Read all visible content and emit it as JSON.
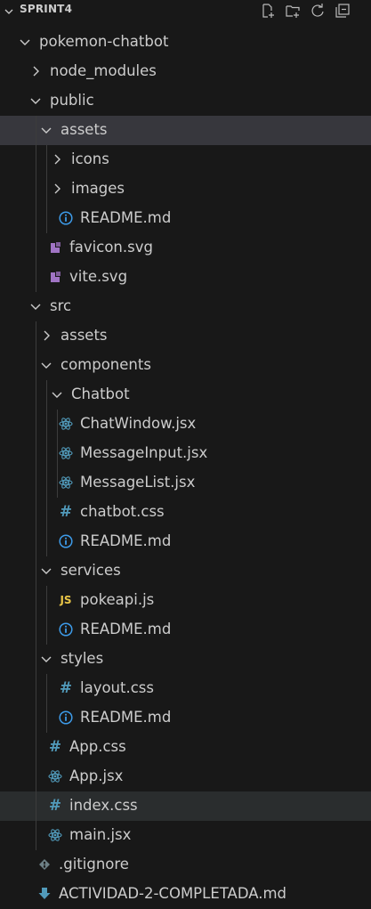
{
  "explorer": {
    "section_title": "SPRINT4",
    "actions": [
      "new-file-icon",
      "new-folder-icon",
      "refresh-icon",
      "collapse-all-icon"
    ]
  },
  "tree": [
    {
      "label": "pokemon-chatbot",
      "depth": 0,
      "kind": "folder",
      "expanded": true
    },
    {
      "label": "node_modules",
      "depth": 1,
      "kind": "folder",
      "expanded": false
    },
    {
      "label": "public",
      "depth": 1,
      "kind": "folder",
      "expanded": true
    },
    {
      "label": "assets",
      "depth": 2,
      "kind": "folder",
      "expanded": true,
      "selected": true
    },
    {
      "label": "icons",
      "depth": 3,
      "kind": "folder",
      "expanded": false
    },
    {
      "label": "images",
      "depth": 3,
      "kind": "folder",
      "expanded": false
    },
    {
      "label": "README.md",
      "depth": 3,
      "kind": "info"
    },
    {
      "label": "favicon.svg",
      "depth": 2,
      "kind": "svg"
    },
    {
      "label": "vite.svg",
      "depth": 2,
      "kind": "svg"
    },
    {
      "label": "src",
      "depth": 1,
      "kind": "folder",
      "expanded": true
    },
    {
      "label": "assets",
      "depth": 2,
      "kind": "folder",
      "expanded": false
    },
    {
      "label": "components",
      "depth": 2,
      "kind": "folder",
      "expanded": true
    },
    {
      "label": "Chatbot",
      "depth": 3,
      "kind": "folder",
      "expanded": true
    },
    {
      "label": "ChatWindow.jsx",
      "depth": 4,
      "kind": "react"
    },
    {
      "label": "MessageInput.jsx",
      "depth": 4,
      "kind": "react"
    },
    {
      "label": "MessageList.jsx",
      "depth": 4,
      "kind": "react"
    },
    {
      "label": "chatbot.css",
      "depth": 3,
      "kind": "css"
    },
    {
      "label": "README.md",
      "depth": 3,
      "kind": "info"
    },
    {
      "label": "services",
      "depth": 2,
      "kind": "folder",
      "expanded": true
    },
    {
      "label": "pokeapi.js",
      "depth": 3,
      "kind": "js"
    },
    {
      "label": "README.md",
      "depth": 3,
      "kind": "info"
    },
    {
      "label": "styles",
      "depth": 2,
      "kind": "folder",
      "expanded": true
    },
    {
      "label": "layout.css",
      "depth": 3,
      "kind": "css"
    },
    {
      "label": "README.md",
      "depth": 3,
      "kind": "info"
    },
    {
      "label": "App.css",
      "depth": 2,
      "kind": "css"
    },
    {
      "label": "App.jsx",
      "depth": 2,
      "kind": "react"
    },
    {
      "label": "index.css",
      "depth": 2,
      "kind": "css",
      "hover": true
    },
    {
      "label": "main.jsx",
      "depth": 2,
      "kind": "react"
    },
    {
      "label": ".gitignore",
      "depth": 1,
      "kind": "git"
    },
    {
      "label": "ACTIVIDAD-2-COMPLETADA.md",
      "depth": 1,
      "kind": "download"
    }
  ],
  "icon_colors": {
    "chevron": "#cccccc",
    "info": "#3d9be9",
    "svg": "#a074c4",
    "react": "#519aba",
    "css": "#519aba",
    "js": "#e8c547",
    "git": "#6d8086",
    "download": "#519aba"
  }
}
